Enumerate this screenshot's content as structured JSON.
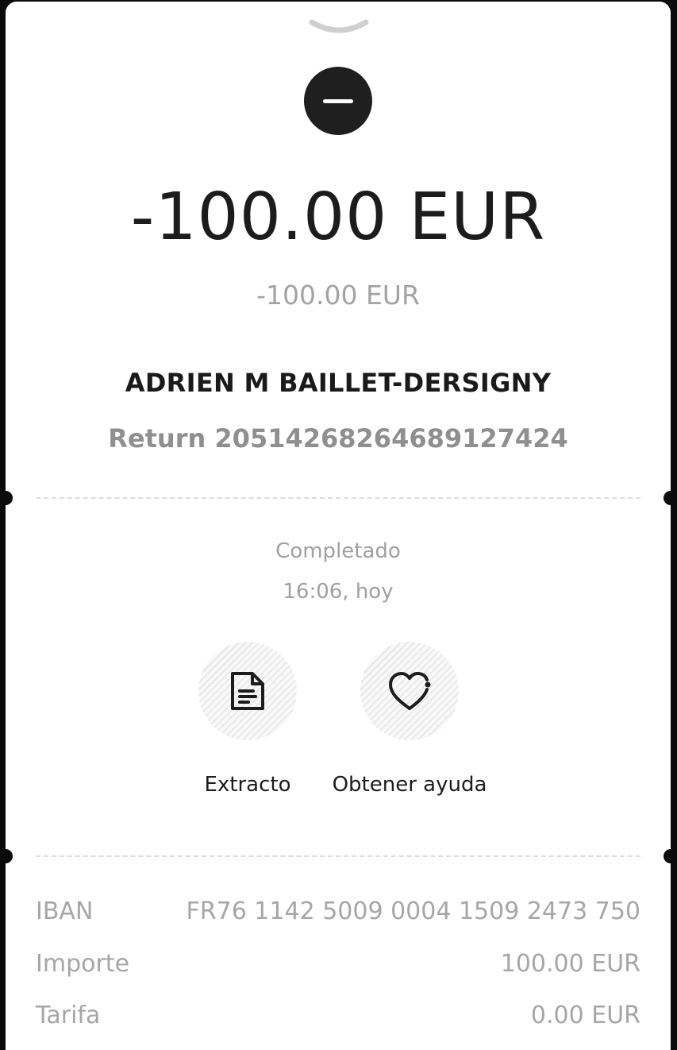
{
  "transaction": {
    "amount": "-100.00 EUR",
    "amount_secondary": "-100.00 EUR",
    "recipient": "ADRIEN M BAILLET-DERSIGNY",
    "reference": "Return 20514268264689127424",
    "status": "Completado",
    "time": "16:06, hoy"
  },
  "actions": [
    {
      "label": "Extracto",
      "icon": "document-icon"
    },
    {
      "label": "Obtener ayuda",
      "icon": "heart-icon"
    }
  ],
  "details": [
    {
      "label": "IBAN",
      "value": "FR76 1142 5009 0004 1509 2473 750"
    },
    {
      "label": "Importe",
      "value": "100.00 EUR"
    },
    {
      "label": "Tarifa",
      "value": "0.00 EUR"
    }
  ],
  "colors": {
    "primary_text": "#1c1c1c",
    "muted_text": "#a3a3a3",
    "background": "#ffffff",
    "status_icon": "#1f1f1f"
  }
}
